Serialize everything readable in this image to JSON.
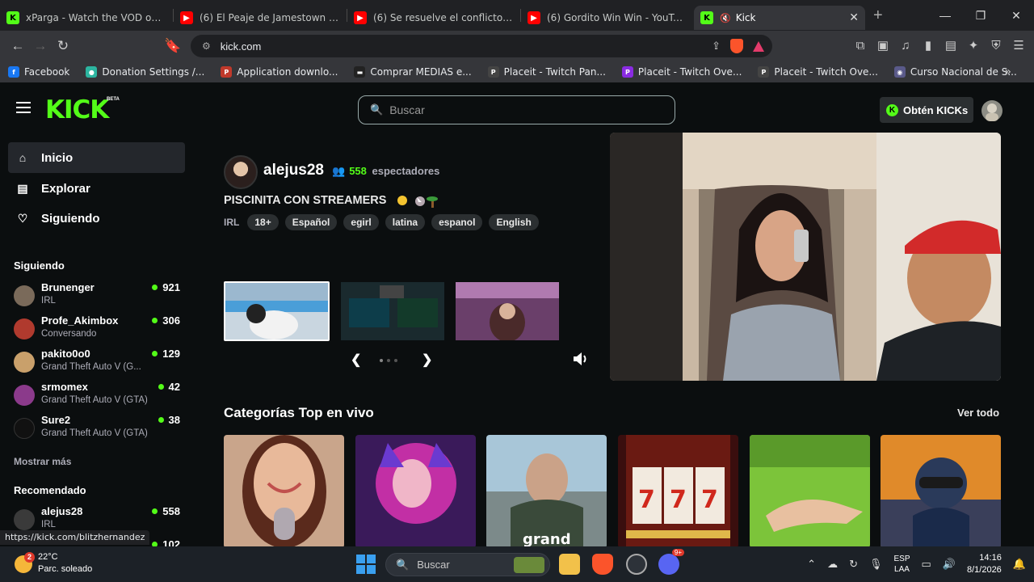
{
  "browser": {
    "tabs": [
      {
        "title": "xParga - Watch the VOD on Kick",
        "favicon": "kick-logo",
        "active": false
      },
      {
        "title": "(6) El Peaje de Jamestown | Invasió",
        "favicon": "youtube-logo",
        "active": false
      },
      {
        "title": "(6) Se resuelve el conflicto? | Reun",
        "favicon": "youtube-logo",
        "active": false
      },
      {
        "title": "(6) Gordito Win Win - YouTube",
        "favicon": "youtube-logo",
        "active": false
      },
      {
        "title": "Kick",
        "favicon": "kick-logo",
        "active": true
      }
    ],
    "url": "kick.com",
    "bookmarks": [
      {
        "label": "Facebook",
        "color": "#1877f2"
      },
      {
        "label": "Donation Settings /...",
        "color": "#2cb5a0"
      },
      {
        "label": "Application downlo...",
        "color": "#c0392b"
      },
      {
        "label": "Comprar MEDIAS e...",
        "color": "#222222"
      },
      {
        "label": "Placeit - Twitch Pan...",
        "color": "#444444"
      },
      {
        "label": "Placeit - Twitch Ove...",
        "color": "#8a2be2"
      },
      {
        "label": "Placeit - Twitch Ove...",
        "color": "#444444"
      },
      {
        "label": "Curso Nacional de S...",
        "color": "#5a5a8a"
      }
    ],
    "status_url": "https://kick.com/blitzhernandez"
  },
  "kick": {
    "accent": "#53fc18",
    "logo": "KICK",
    "beta": "BETA",
    "search_placeholder": "Buscar",
    "get_kicks": "Obtén KICKs",
    "nav": [
      {
        "label": "Inicio",
        "icon": "home-icon"
      },
      {
        "label": "Explorar",
        "icon": "explore-icon"
      },
      {
        "label": "Siguiendo",
        "icon": "heart-icon"
      }
    ],
    "following_title": "Siguiendo",
    "following": [
      {
        "name": "Brunenger",
        "category": "IRL",
        "viewers": "921",
        "color": "#7a6a5a"
      },
      {
        "name": "Profe_Akimbox",
        "category": "Conversando",
        "viewers": "306",
        "color": "#b03a2e"
      },
      {
        "name": "pakito0o0",
        "category": "Grand Theft Auto V (G...",
        "viewers": "129",
        "color": "#c9a06b"
      },
      {
        "name": "srmomex",
        "category": "Grand Theft Auto V (GTA)",
        "viewers": "42",
        "color": "#8b3a8b"
      },
      {
        "name": "Sure2",
        "category": "Grand Theft Auto V (GTA)",
        "viewers": "38",
        "color": "#111111"
      }
    ],
    "show_more": "Mostrar más",
    "recommended_title": "Recomendado",
    "recommended": [
      {
        "name": "alejus28",
        "category": "IRL",
        "viewers": "558",
        "color": "#3a3a3a"
      }
    ],
    "recommended_partial_viewers": "102",
    "featured": {
      "streamer": "alejus28",
      "viewers": "558",
      "viewers_label": "espectadores",
      "title": "PISCINITA CON STREAMERS",
      "category": "IRL",
      "tags": [
        "18+",
        "Español",
        "egirl",
        "latina",
        "espanol",
        "English"
      ]
    },
    "categories_title": "Categorías Top en vivo",
    "see_all": "Ver todo"
  },
  "taskbar": {
    "temperature": "22°C",
    "weather": "Parc. soleado",
    "weather_badge": "2",
    "search_placeholder": "Buscar",
    "lang_line1": "ESP",
    "lang_line2": "LAA",
    "time": "14:16",
    "date": "8/1/2026",
    "discord_badge": "9+"
  }
}
